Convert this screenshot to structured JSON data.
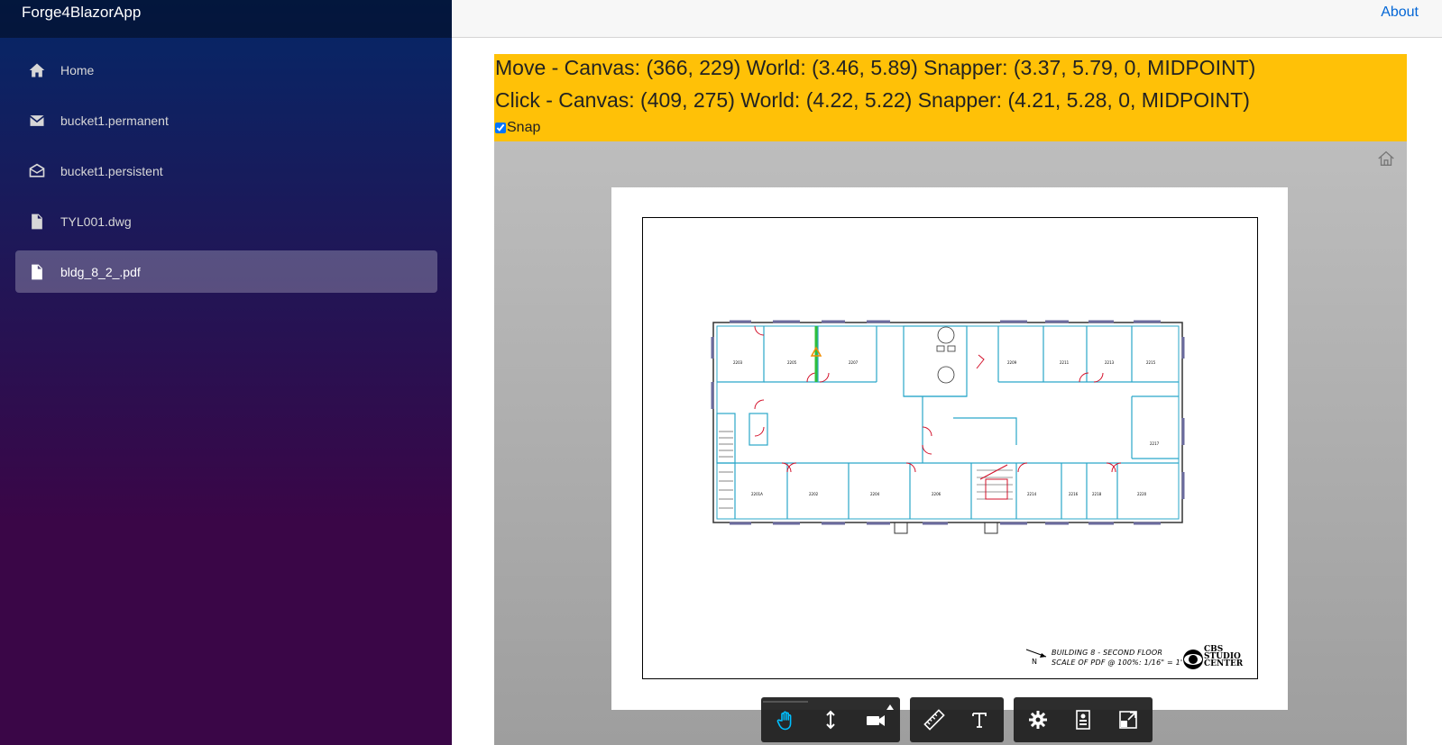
{
  "app": {
    "brand": "Forge4BlazorApp",
    "about_label": "About"
  },
  "sidebar": {
    "items": [
      {
        "label": "Home",
        "icon": "home-icon",
        "active": false
      },
      {
        "label": "bucket1.permanent",
        "icon": "mail-icon",
        "active": false
      },
      {
        "label": "bucket1.persistent",
        "icon": "open-mail-icon",
        "active": false
      },
      {
        "label": "TYL001.dwg",
        "icon": "file-icon",
        "active": false
      },
      {
        "label": "bldg_8_2_.pdf",
        "icon": "file-icon",
        "active": true
      }
    ]
  },
  "info": {
    "move_line": "Move - Canvas: (366, 229) World: (3.46, 5.89) Snapper: (3.37, 5.79, 0, MIDPOINT)",
    "click_line": "Click - Canvas: (409, 275) World: (4.22, 5.22) Snapper: (4.21, 5.28, 0, MIDPOINT)",
    "snap_label": "Snap",
    "snap_checked": true
  },
  "drawing": {
    "title_line1": "BUILDING 8 - SECOND FLOOR",
    "title_line2": "SCALE OF PDF @ 100%: 1/16\" = 1'",
    "logo_text": "CBS STUDIO CENTER"
  },
  "toolbar": {
    "groups": [
      [
        "pan-icon",
        "dolly-icon",
        "camera-icon"
      ],
      [
        "measure-icon",
        "text-icon"
      ],
      [
        "settings-icon",
        "properties-icon",
        "fullscreen-icon"
      ]
    ]
  },
  "colors": {
    "info_bg": "#ffc107",
    "sidebar_top": "#052767",
    "sidebar_bottom": "#3a0647",
    "link": "#0366d6",
    "toolbar_bg": "#222222",
    "active_tool": "#00bfff"
  }
}
